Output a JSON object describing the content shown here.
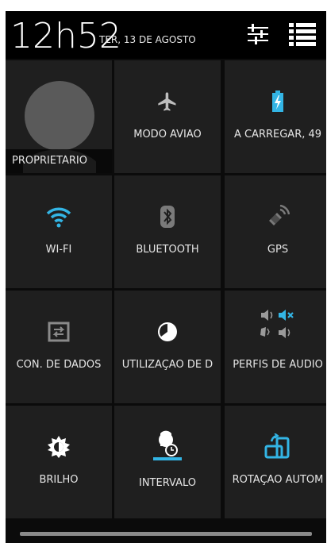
{
  "status": {
    "time": "12h52",
    "date": "TER, 13 DE AGOSTO"
  },
  "tiles": {
    "owner": "PROPRIETÁRIO",
    "airplane": "MODO AVIÃO",
    "battery": "A CARREGAR, 49",
    "wifi": "WI-FI",
    "bluetooth": "BLUETOOTH",
    "gps": "GPS",
    "data": "CON. DE DADOS",
    "usage": "UTILIZAÇÃO DE D",
    "audio": "PERFIS DE ÁUDIO",
    "brightness": "BRILHO",
    "timeout": "INTERVALO",
    "rotation": "ROTAÇÃO AUTOM"
  },
  "colors": {
    "accent": "#33b5e5",
    "tile_bg": "#1f1f1f",
    "panel_bg": "#0b0b0b"
  },
  "icons": [
    "settings-sliders-icon",
    "list-icon",
    "avatar-icon",
    "airplane-icon",
    "battery-charging-icon",
    "wifi-icon",
    "bluetooth-icon",
    "gps-icon",
    "data-connection-icon",
    "data-usage-icon",
    "audio-profiles-icon",
    "brightness-icon",
    "screen-timeout-icon",
    "auto-rotate-icon"
  ]
}
